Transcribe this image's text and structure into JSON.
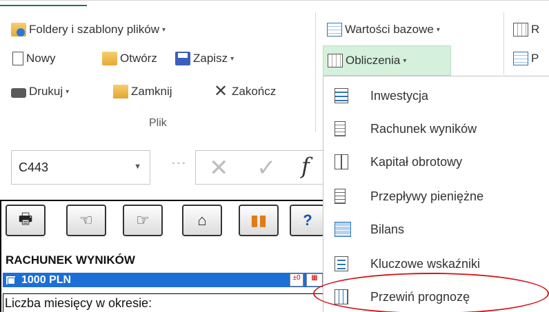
{
  "ribbon": {
    "plik_group": {
      "folders_label": "Foldery i szablony plików",
      "new_label": "Nowy",
      "open_label": "Otwórz",
      "save_label": "Zapisz",
      "print_label": "Drukuj",
      "close_label": "Zamknij",
      "exit_label": "Zakończ",
      "group_name": "Plik"
    },
    "calc_group": {
      "base_values_label": "Wartości bazowe",
      "calculations_label": "Obliczenia",
      "partial_r": "R",
      "partial_p": "P"
    }
  },
  "formula_bar": {
    "name_box": "C443",
    "fx": "f"
  },
  "calc_menu": {
    "items": [
      {
        "label": "Inwestycja",
        "icon": "investment-icon"
      },
      {
        "label": "Rachunek wyników",
        "icon": "income-statement-icon"
      },
      {
        "label": "Kapitał obrotowy",
        "icon": "working-capital-icon"
      },
      {
        "label": "Przepływy pieniężne",
        "icon": "cash-flow-icon"
      },
      {
        "label": "Bilans",
        "icon": "balance-sheet-icon"
      },
      {
        "label": "Kluczowe wskaźniki",
        "icon": "key-indicators-icon"
      },
      {
        "label": "Przewiń prognozę",
        "icon": "rewind-forecast-icon"
      }
    ]
  },
  "sheet": {
    "title": "RACHUNEK WYNIKÓW",
    "unit_row": "1000 PLN",
    "first_row_label": "Liczba miesięcy w okresie:",
    "help_glyph": "?"
  },
  "colors": {
    "highlight": "#d5f0dc",
    "blue_row": "#1c6fd4",
    "annotation_ellipse": "#d4171c"
  }
}
